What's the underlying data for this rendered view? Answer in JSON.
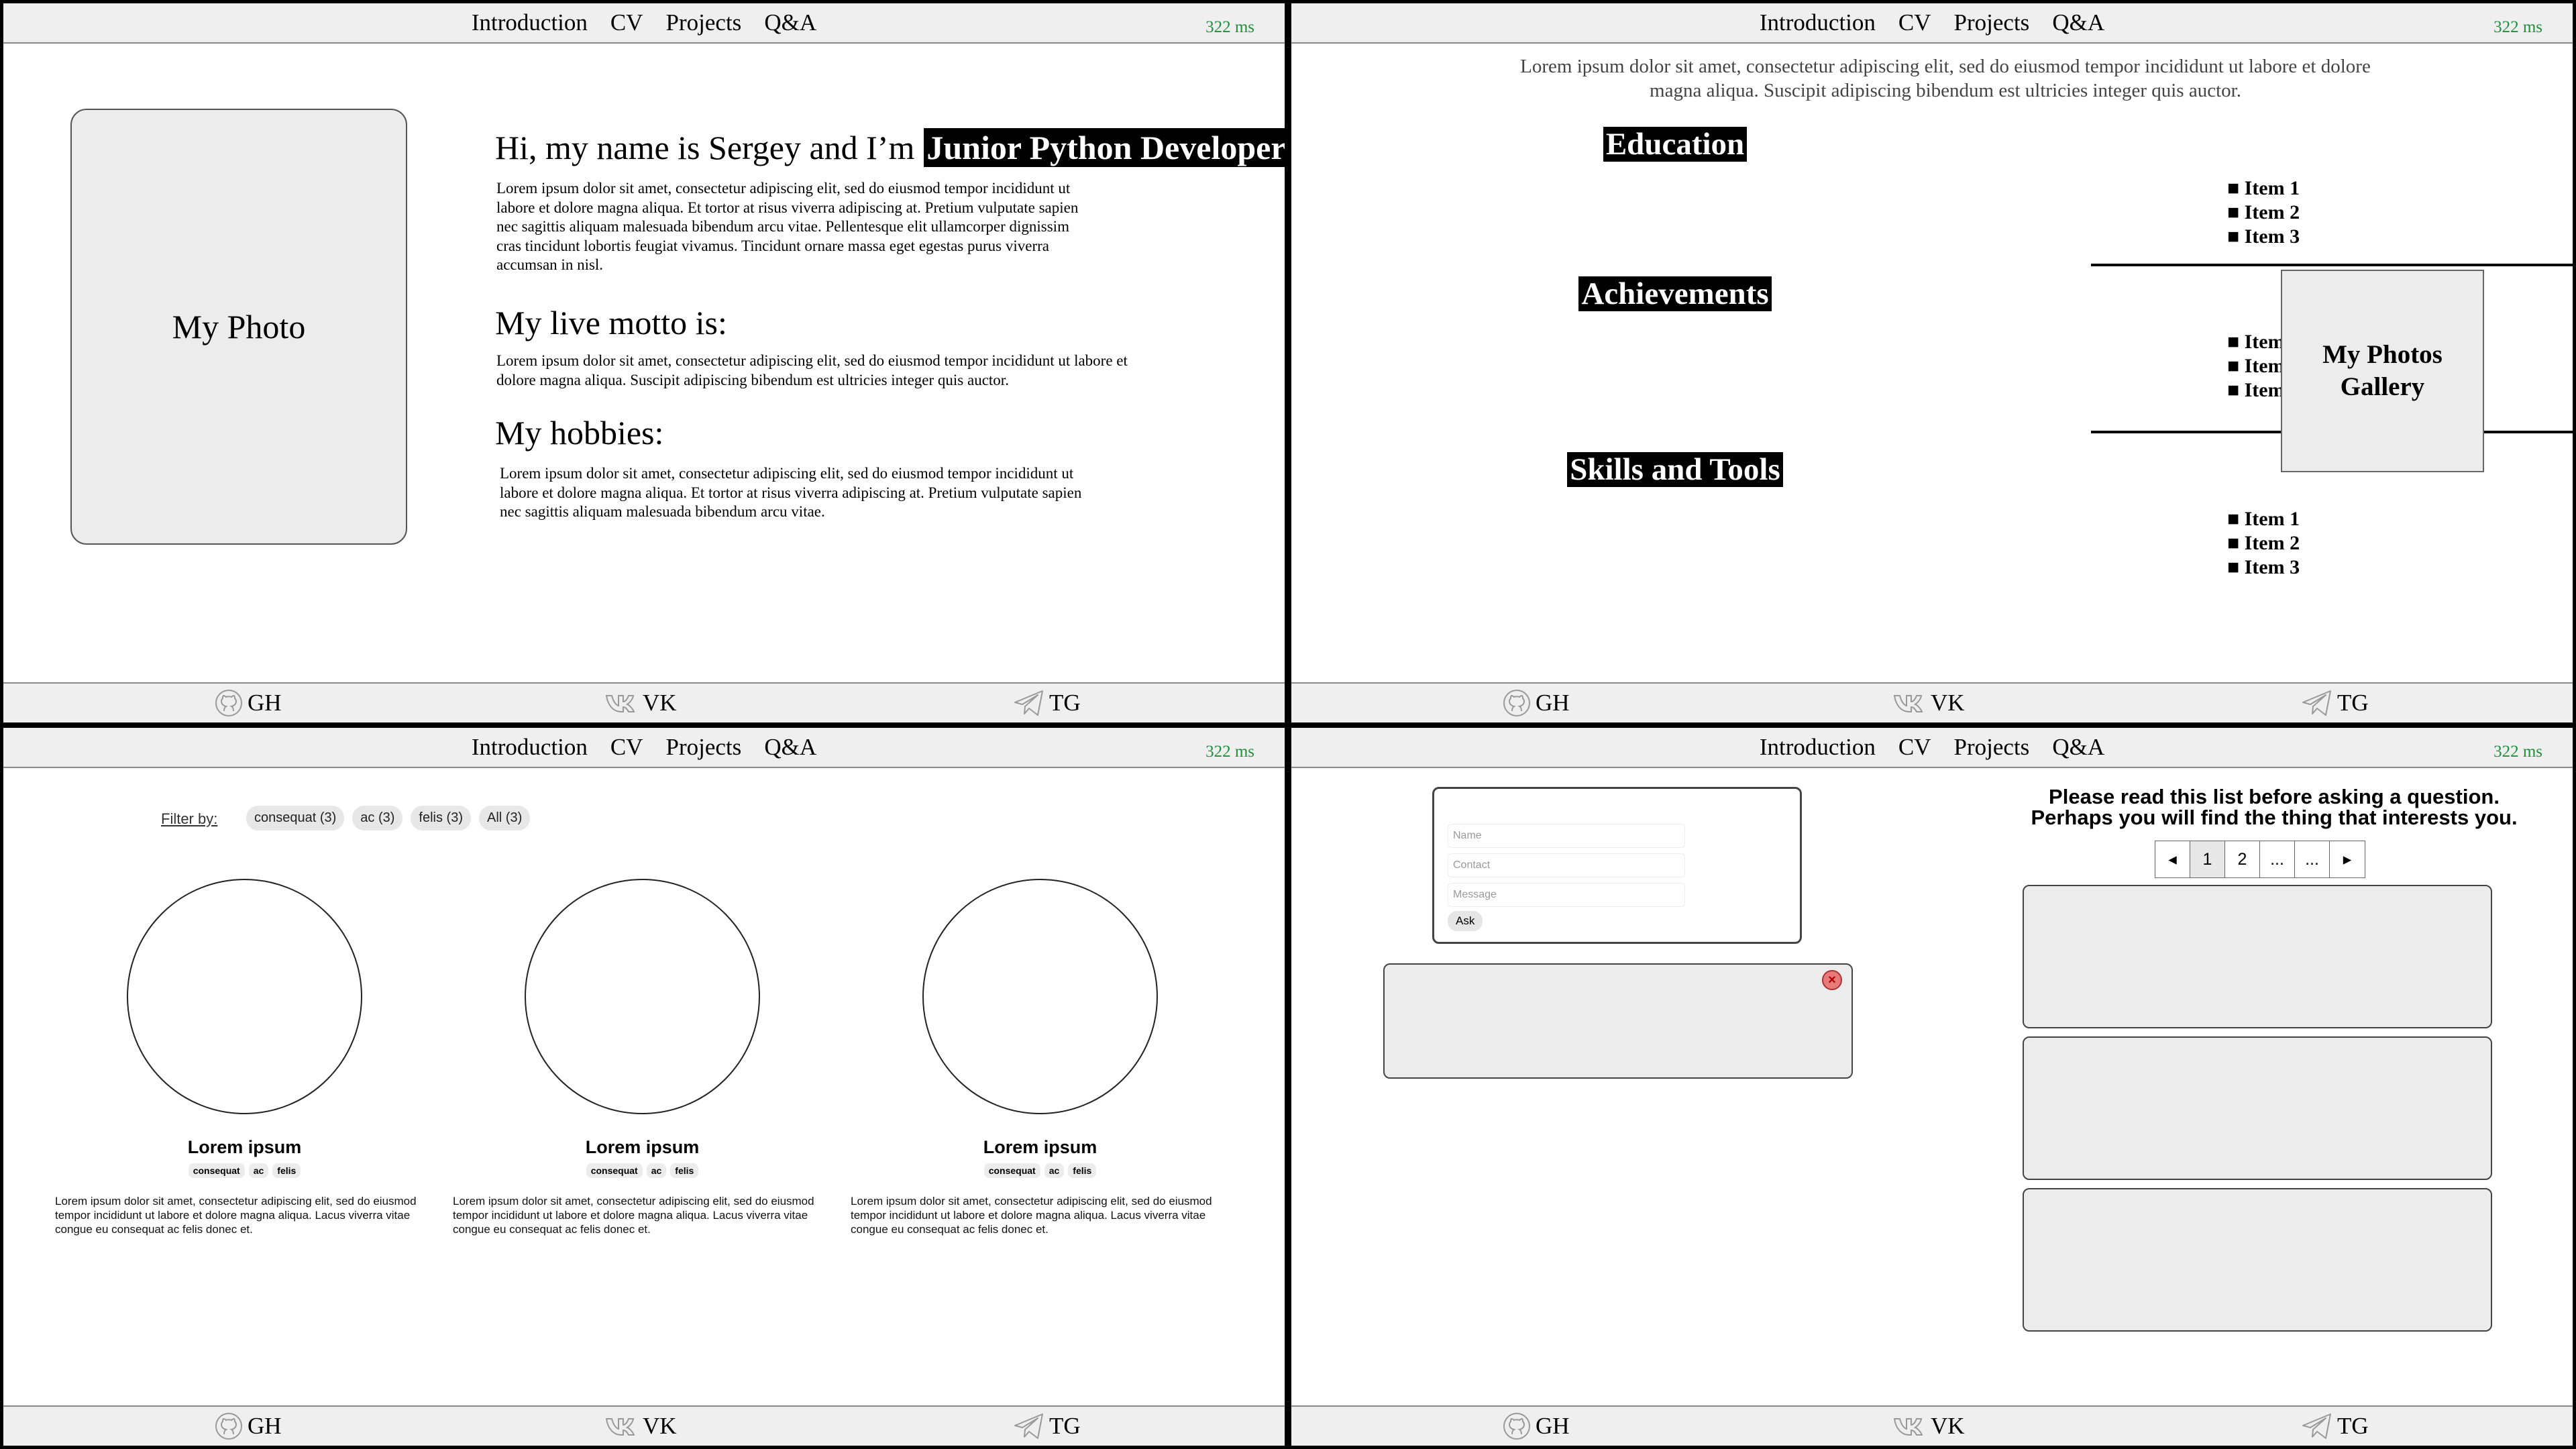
{
  "nav": {
    "items": [
      "Introduction",
      "CV",
      "Projects",
      "Q&A"
    ],
    "ping": "322 ms"
  },
  "footer": {
    "gh": "GH",
    "vk": "VK",
    "tg": "TG"
  },
  "intro": {
    "photo_label": "My Photo",
    "greeting": "Hi, my name is Sergey and I’m",
    "role": "Junior Python Developer",
    "about": "Lorem ipsum dolor sit amet, consectetur adipiscing elit, sed do eiusmod tempor incididunt ut labore et dolore magna aliqua. Et tortor at risus viverra adipiscing at. Pretium vulputate sapien nec sagittis aliquam malesuada bibendum arcu vitae. Pellentesque elit ullamcorper dignissim cras tincidunt lobortis feugiat vivamus. Tincidunt ornare massa eget egestas purus viverra accumsan in nisl.",
    "motto_title": "My live motto is:",
    "motto": "Lorem ipsum dolor sit amet, consectetur adipiscing elit, sed do eiusmod tempor incididunt ut labore et dolore magna aliqua. Suscipit adipiscing bibendum est ultricies integer quis auctor.",
    "hobbies_title": "My hobbies:",
    "hobbies": "Lorem ipsum dolor sit amet, consectetur adipiscing elit, sed do eiusmod tempor incididunt ut labore et dolore magna aliqua. Et tortor at risus viverra adipiscing at. Pretium vulputate sapien nec sagittis aliquam malesuada bibendum arcu vitae."
  },
  "cv": {
    "lead": "Lorem ipsum dolor sit amet, consectetur adipiscing elit, sed do eiusmod tempor incididunt ut labore et dolore magna aliqua. Suscipit adipiscing bibendum est ultricies integer quis auctor.",
    "sections": [
      {
        "title": "Education",
        "items": [
          "Item 1",
          "Item 2",
          "Item 3"
        ]
      },
      {
        "title": "Achievements",
        "items": [
          "Item 1",
          "Item 2",
          "Item 3"
        ]
      },
      {
        "title": "Skills and Tools",
        "items": [
          "Item 1",
          "Item 2",
          "Item 3"
        ]
      }
    ],
    "gallery": "My Photos Gallery"
  },
  "projects": {
    "filter_label": "Filter by:",
    "filters": [
      "consequat (3)",
      "ac (3)",
      "felis (3)",
      "All (3)"
    ],
    "cards": [
      {
        "title": "Lorem ipsum",
        "tags": [
          "consequat",
          "ac",
          "felis"
        ],
        "desc": "Lorem ipsum dolor sit amet, consectetur adipiscing elit, sed do eiusmod tempor incididunt ut labore et dolore magna aliqua. Lacus viverra vitae congue eu consequat ac felis donec et."
      },
      {
        "title": "Lorem ipsum",
        "tags": [
          "consequat",
          "ac",
          "felis"
        ],
        "desc": "Lorem ipsum dolor sit amet, consectetur adipiscing elit, sed do eiusmod tempor incididunt ut labore et dolore magna aliqua. Lacus viverra vitae congue eu consequat ac felis donec et."
      },
      {
        "title": "Lorem ipsum",
        "tags": [
          "consequat",
          "ac",
          "felis"
        ],
        "desc": "Lorem ipsum dolor sit amet, consectetur adipiscing elit, sed do eiusmod tempor incididunt ut labore et dolore magna aliqua. Lacus viverra vitae congue eu consequat ac felis donec et."
      }
    ]
  },
  "qa": {
    "name_ph": "Name",
    "contact_ph": "Contact",
    "message_ph": "Message",
    "ask": "Ask",
    "close": "×",
    "heading1": "Please read this list before asking a question.",
    "heading2": "Perhaps you will find the thing that interests you.",
    "pages": [
      "◂",
      "1",
      "2",
      "...",
      "...",
      "▸"
    ]
  }
}
